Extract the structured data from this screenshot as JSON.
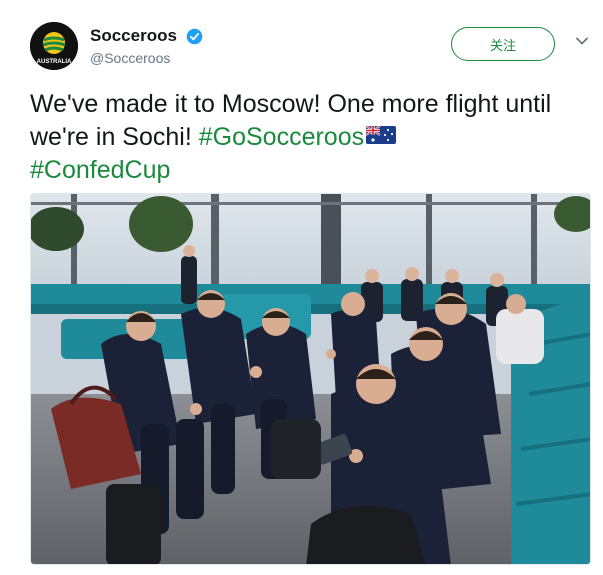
{
  "account": {
    "display_name": "Socceroos",
    "handle": "@Socceroos",
    "verified": true,
    "avatar_text": "AUSTRALIA"
  },
  "follow_button": {
    "label": "关注"
  },
  "tweet": {
    "text_part1": "We've made it to Moscow! One more flight until we're in Sochi! ",
    "hashtag1": "#GoSocceroos",
    "hashtag2": "#ConfedCup",
    "emoji": "australian-flag"
  },
  "media": {
    "type": "photo"
  },
  "colors": {
    "accent": "#1a8a3c",
    "verified": "#1da1f2"
  }
}
